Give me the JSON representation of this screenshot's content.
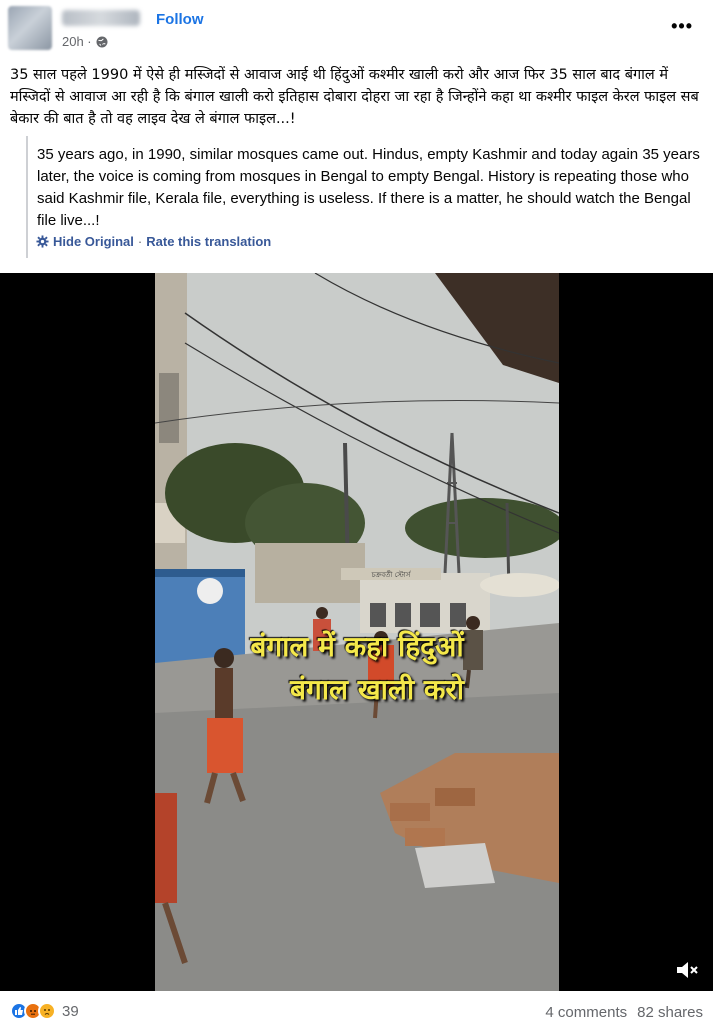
{
  "post": {
    "follow_label": "Follow",
    "time": "20h ·",
    "more_label": "•••",
    "caption": "35 साल पहले 1990 में ऐसे ही मस्जिदों से आवाज आई थी हिंदुओं कश्मीर खाली करो और आज फिर 35 साल बाद बंगाल में मस्जिदों से आवाज आ रही है कि बंगाल खाली करो इतिहास दोबारा दोहरा जा रहा है जिन्होंने कहा था कश्मीर फाइल केरल फाइल सब बेकार की बात है तो वह लाइव देख ले बंगाल फाइल...!"
  },
  "translation": {
    "text": "35 years ago, in 1990, similar mosques came out. Hindus, empty Kashmir and today again 35 years later, the voice is coming from mosques in Bengal to empty Bengal. History is repeating those who said Kashmir file, Kerala file, everything is useless. If there is a matter, he should watch the Bengal file live...!",
    "hide_label": "Hide Original",
    "separator": "·",
    "rate_label": "Rate this translation"
  },
  "video": {
    "overlay_line1": "बंगाल में कहा हिंदुओं",
    "overlay_line2": "बंगाल खाली करो",
    "store_sign": "চক্রবর্তী স্টোর্স"
  },
  "footer": {
    "reaction_count": "39",
    "comments": "4 comments",
    "shares": "82 shares"
  },
  "icons": {
    "globe": "globe-icon",
    "gear": "gear-icon",
    "mute": "speaker-muted-icon",
    "like": "like-reaction-icon",
    "angry": "angry-reaction-icon",
    "sad": "sad-reaction-icon"
  },
  "colors": {
    "link": "#1b74e4",
    "translation_link": "#385898",
    "secondary_text": "#65676b",
    "overlay_text": "#f4e84a"
  }
}
